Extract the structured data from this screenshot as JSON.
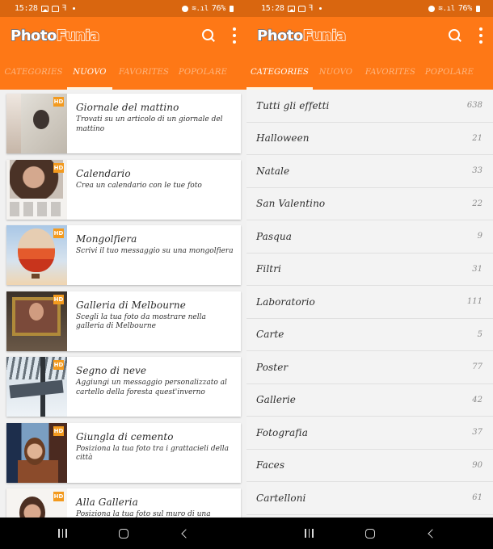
{
  "status_bar": {
    "time": "15:28",
    "battery": "76%"
  },
  "app": {
    "logo_part1": "Photo",
    "logo_part2": "Funia",
    "search_icon": "search-icon",
    "more_icon": "more-vert-icon",
    "brand_color": "#fe7816",
    "status_bar_color": "#d9660f"
  },
  "tabs": [
    {
      "label": "CATEGORIES"
    },
    {
      "label": "NUOVO"
    },
    {
      "label": "FAVORITES"
    },
    {
      "label": "POPOLARE"
    }
  ],
  "screens": [
    {
      "active_tab": "NUOVO"
    },
    {
      "active_tab": "CATEGORIES"
    }
  ],
  "new_effects": [
    {
      "title": "Giornale del mattino",
      "description": "Trovati su un articolo di un giornale del mattino",
      "badge": "HD"
    },
    {
      "title": "Calendario",
      "description": "Crea un calendario con le tue foto",
      "badge": "HD"
    },
    {
      "title": "Mongolfiera",
      "description": "Scrivi il tuo messaggio su una mongolfiera",
      "badge": "HD"
    },
    {
      "title": "Galleria di Melbourne",
      "description": "Scegli la tua foto da mostrare nella galleria di Melbourne",
      "badge": "HD"
    },
    {
      "title": "Segno di neve",
      "description": "Aggiungi un messaggio personalizzato al cartello della foresta quest'inverno",
      "badge": "HD"
    },
    {
      "title": "Giungla di cemento",
      "description": "Posiziona la tua foto tra i grattacieli della città",
      "badge": "HD"
    },
    {
      "title": "Alla Galleria",
      "description": "Posiziona la tua foto sul muro di una",
      "badge": "HD"
    }
  ],
  "categories": [
    {
      "name": "Tutti gli effetti",
      "count": "638"
    },
    {
      "name": "Halloween",
      "count": "21"
    },
    {
      "name": "Natale",
      "count": "33"
    },
    {
      "name": "San Valentino",
      "count": "22"
    },
    {
      "name": "Pasqua",
      "count": "9"
    },
    {
      "name": "Filtri",
      "count": "31"
    },
    {
      "name": "Laboratorio",
      "count": "111"
    },
    {
      "name": "Carte",
      "count": "5"
    },
    {
      "name": "Poster",
      "count": "77"
    },
    {
      "name": "Gallerie",
      "count": "42"
    },
    {
      "name": "Fotografia",
      "count": "37"
    },
    {
      "name": "Faces",
      "count": "90"
    },
    {
      "name": "Cartelloni",
      "count": "61"
    }
  ],
  "nav_bar": {
    "recents_icon": "recents-icon",
    "home_icon": "home-icon",
    "back_icon": "back-icon"
  }
}
